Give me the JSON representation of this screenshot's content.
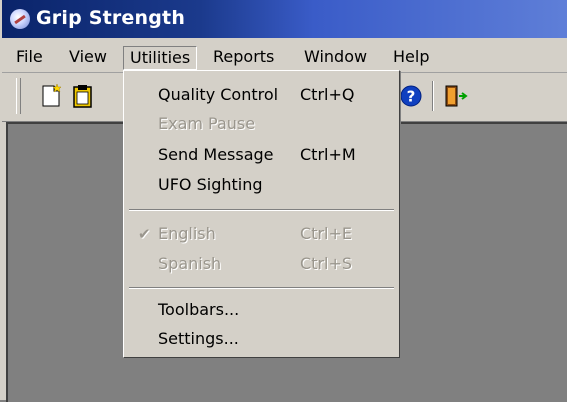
{
  "window": {
    "title": "Grip Strength"
  },
  "menubar": {
    "items": [
      {
        "label": "File"
      },
      {
        "label": "View"
      },
      {
        "label": "Utilities"
      },
      {
        "label": "Reports"
      },
      {
        "label": "Window"
      },
      {
        "label": "Help"
      }
    ]
  },
  "toolbar": {
    "icons": [
      "new-document-icon",
      "clipboard-icon",
      "help-icon",
      "exit-door-icon"
    ],
    "help_glyph": "?"
  },
  "utilities_menu": {
    "items": [
      {
        "label": "Quality Control",
        "shortcut": "Ctrl+Q",
        "enabled": true
      },
      {
        "label": "Exam Pause",
        "shortcut": "",
        "enabled": false
      },
      {
        "label": "Send Message",
        "shortcut": "Ctrl+M",
        "enabled": true
      },
      {
        "label": "UFO Sighting",
        "shortcut": "",
        "enabled": true
      },
      {
        "label": "English",
        "shortcut": "Ctrl+E",
        "enabled": false,
        "checked": true
      },
      {
        "label": "Spanish",
        "shortcut": "Ctrl+S",
        "enabled": false
      },
      {
        "label": "Toolbars...",
        "shortcut": "",
        "enabled": true
      },
      {
        "label": "Settings...",
        "shortcut": "",
        "enabled": true
      }
    ],
    "check_glyph": "✔"
  },
  "colors": {
    "face": "#d4d0c8",
    "titlebar_start": "#0a246a",
    "titlebar_end": "#5f7fd8",
    "client": "#808080",
    "disabled_text": "#9a968d"
  }
}
